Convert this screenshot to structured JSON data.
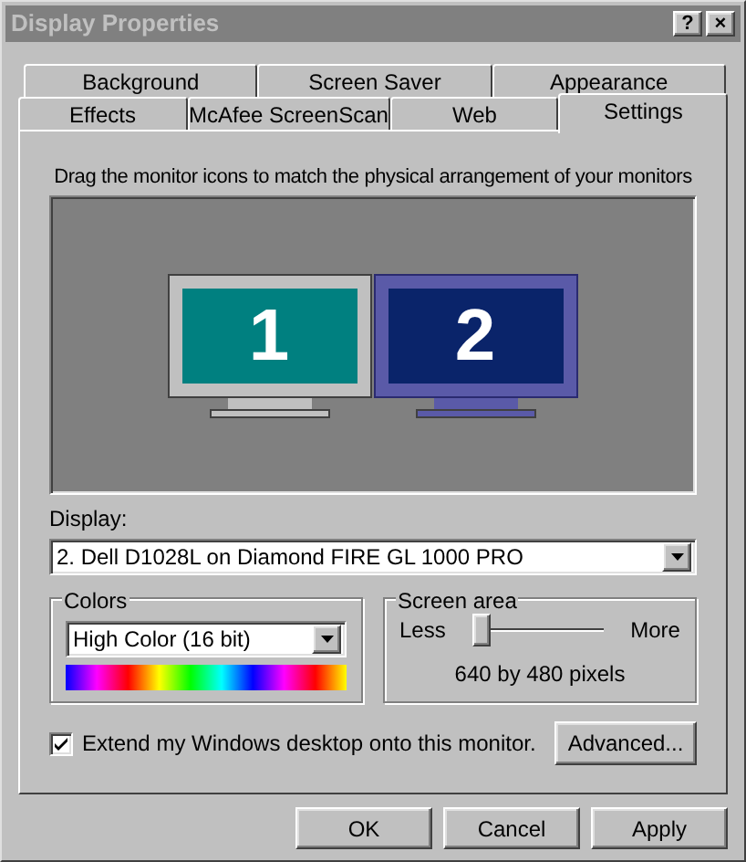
{
  "window": {
    "title": "Display Properties",
    "title_buttons": [
      "?",
      "×"
    ]
  },
  "tab_rows": [
    [
      {
        "label": "Background",
        "selected": false
      },
      {
        "label": "Screen Saver",
        "selected": false
      },
      {
        "label": "Appearance",
        "selected": false
      }
    ],
    [
      {
        "label": "Effects",
        "selected": false
      },
      {
        "label": "McAfee ScreenScan",
        "selected": false
      },
      {
        "label": "Web",
        "selected": false
      },
      {
        "label": "Settings",
        "selected": true
      }
    ]
  ],
  "instruction": "Drag the monitor icons to match the physical arrangement of your monitors",
  "monitors": [
    {
      "number": "1",
      "selected": false
    },
    {
      "number": "2",
      "selected": true
    }
  ],
  "display": {
    "label": "Display:",
    "value": "2. Dell D1028L on Diamond FIRE GL 1000 PRO"
  },
  "colors": {
    "title": "Colors",
    "value": "High Color (16 bit)"
  },
  "screen_area": {
    "title": "Screen area",
    "less": "Less",
    "more": "More",
    "level": 0,
    "reading": "640 by 480 pixels"
  },
  "extend_checkbox": {
    "label": "Extend my Windows desktop onto this monitor.",
    "checked": true
  },
  "advanced_button": "Advanced...",
  "buttons": [
    "OK",
    "Cancel",
    "Apply"
  ]
}
